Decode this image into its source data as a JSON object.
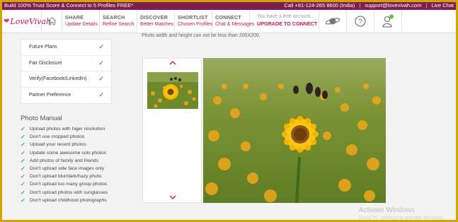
{
  "topbar": {
    "promo": "Build 100% Trust Score & Connect to 5 Profiles FREE*",
    "call": "Call +91-124-265 8600 (India)",
    "separator": "|",
    "email": "support@lovevivah.com",
    "live_chat": "Live Chat"
  },
  "header": {
    "logo": "LoveVivah",
    "nav": [
      {
        "title": "SHARE",
        "sub": "Update Details"
      },
      {
        "title": "SEARCH",
        "sub": "Refine Search"
      },
      {
        "title": "DISCOVER",
        "sub": "Better Matches"
      },
      {
        "title": "SHORTLIST",
        "sub": "Chosen Profiles"
      },
      {
        "title": "CONNECT",
        "sub": "Chat & Messages"
      }
    ],
    "account": {
      "note": "You have a free account.",
      "cta": "UPGRADE TO CONNECT"
    }
  },
  "main": {
    "photo_note": "Photo width and height can not be less than 200X200.",
    "menu": [
      "Future Plans",
      "Fair Disclosure",
      "Verify(Facebook/LinkedIn)",
      "Partner Preference"
    ],
    "manual_title": "Photo Manual",
    "manual_items": [
      "Upload photos with higer resolution",
      "Don't use cropped photos",
      "Upload your recent photos",
      "Update some awesome solo photos",
      " Add photos of family and friends",
      "Don't upload side face images only",
      "Don't upload blur/dark/hazy photo",
      "Don't upload too many group photos",
      "Don't upload photos with sunglasses",
      "Don't upload childhood photographs"
    ]
  },
  "watermark": {
    "title": "Activate Windows",
    "sub": "Go to PC settings to activate Windows."
  },
  "colors": {
    "brand": "#c2185b",
    "topbar": "#7e1f52",
    "check": "#4caf50"
  }
}
